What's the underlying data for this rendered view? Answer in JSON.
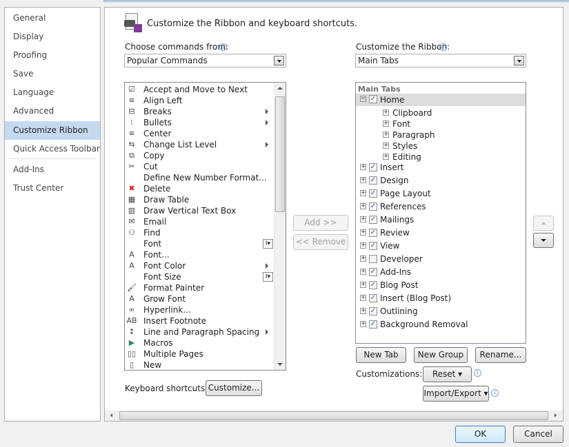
{
  "sidebar": {
    "items": [
      {
        "label": "General"
      },
      {
        "label": "Display"
      },
      {
        "label": "Proofing"
      },
      {
        "label": "Save"
      },
      {
        "label": "Language"
      },
      {
        "label": "Advanced"
      },
      {
        "label": "Customize Ribbon",
        "selected": true
      },
      {
        "label": "Quick Access Toolbar"
      },
      {
        "label": "Add-Ins"
      },
      {
        "label": "Trust Center"
      }
    ]
  },
  "header": {
    "title": "Customize the Ribbon and keyboard shortcuts."
  },
  "left": {
    "label": "Choose commands from:",
    "selected": "Popular Commands",
    "commands": [
      {
        "label": "Accept and Move to Next",
        "icon": "checkmark-doc-icon"
      },
      {
        "label": "Align Left",
        "icon": "align-left-icon"
      },
      {
        "label": "Breaks",
        "icon": "breaks-icon",
        "submenu": true
      },
      {
        "label": "Bullets",
        "icon": "bullets-icon",
        "submenu": true
      },
      {
        "label": "Center",
        "icon": "align-center-icon"
      },
      {
        "label": "Change List Level",
        "icon": "list-level-icon",
        "submenu": true
      },
      {
        "label": "Copy",
        "icon": "copy-icon"
      },
      {
        "label": "Cut",
        "icon": "scissors-icon"
      },
      {
        "label": "Define New Number Format...",
        "icon": ""
      },
      {
        "label": "Delete",
        "icon": "delete-x-icon"
      },
      {
        "label": "Draw Table",
        "icon": "draw-table-icon"
      },
      {
        "label": "Draw Vertical Text Box",
        "icon": "text-box-icon"
      },
      {
        "label": "Email",
        "icon": "email-icon"
      },
      {
        "label": "Find",
        "icon": "binoculars-icon"
      },
      {
        "label": "Font",
        "icon": "",
        "ibox": true
      },
      {
        "label": "Font...",
        "icon": "font-a-icon"
      },
      {
        "label": "Font Color",
        "icon": "font-color-icon",
        "submenu": true
      },
      {
        "label": "Font Size",
        "icon": "",
        "ibox": true
      },
      {
        "label": "Format Painter",
        "icon": "brush-icon"
      },
      {
        "label": "Grow Font",
        "icon": "grow-font-icon"
      },
      {
        "label": "Hyperlink...",
        "icon": "link-icon"
      },
      {
        "label": "Insert Footnote",
        "icon": "footnote-icon"
      },
      {
        "label": "Line and Paragraph Spacing",
        "icon": "line-spacing-icon",
        "submenu": true
      },
      {
        "label": "Macros",
        "icon": "play-icon"
      },
      {
        "label": "Multiple Pages",
        "icon": "pages-icon"
      },
      {
        "label": "New",
        "icon": "new-doc-icon"
      }
    ]
  },
  "keyboard": {
    "label": "Keyboard shortcuts:",
    "button": "Customize..."
  },
  "middle": {
    "add": "Add >>",
    "remove": "<< Remove"
  },
  "right": {
    "label": "Customize the Ribbon:",
    "selected": "Main Tabs",
    "tree_header": "Main Tabs",
    "home": {
      "label": "Home",
      "checked": true,
      "groups": [
        "Clipboard",
        "Font",
        "Paragraph",
        "Styles",
        "Editing"
      ]
    },
    "tabs": [
      {
        "label": "Insert",
        "checked": true
      },
      {
        "label": "Design",
        "checked": true
      },
      {
        "label": "Page Layout",
        "checked": true
      },
      {
        "label": "References",
        "checked": true
      },
      {
        "label": "Mailings",
        "checked": true
      },
      {
        "label": "Review",
        "checked": true
      },
      {
        "label": "View",
        "checked": true
      },
      {
        "label": "Developer",
        "checked": false
      },
      {
        "label": "Add-Ins",
        "checked": true
      },
      {
        "label": "Blog Post",
        "checked": true
      },
      {
        "label": "Insert (Blog Post)",
        "checked": true
      },
      {
        "label": "Outlining",
        "checked": true
      },
      {
        "label": "Background Removal",
        "checked": true
      }
    ],
    "new_tab": "New Tab",
    "new_group": "New Group",
    "rename": "Rename...",
    "customizations_label": "Customizations:",
    "reset": "Reset",
    "import_export": "Import/Export"
  },
  "footer": {
    "ok": "OK",
    "cancel": "Cancel"
  }
}
